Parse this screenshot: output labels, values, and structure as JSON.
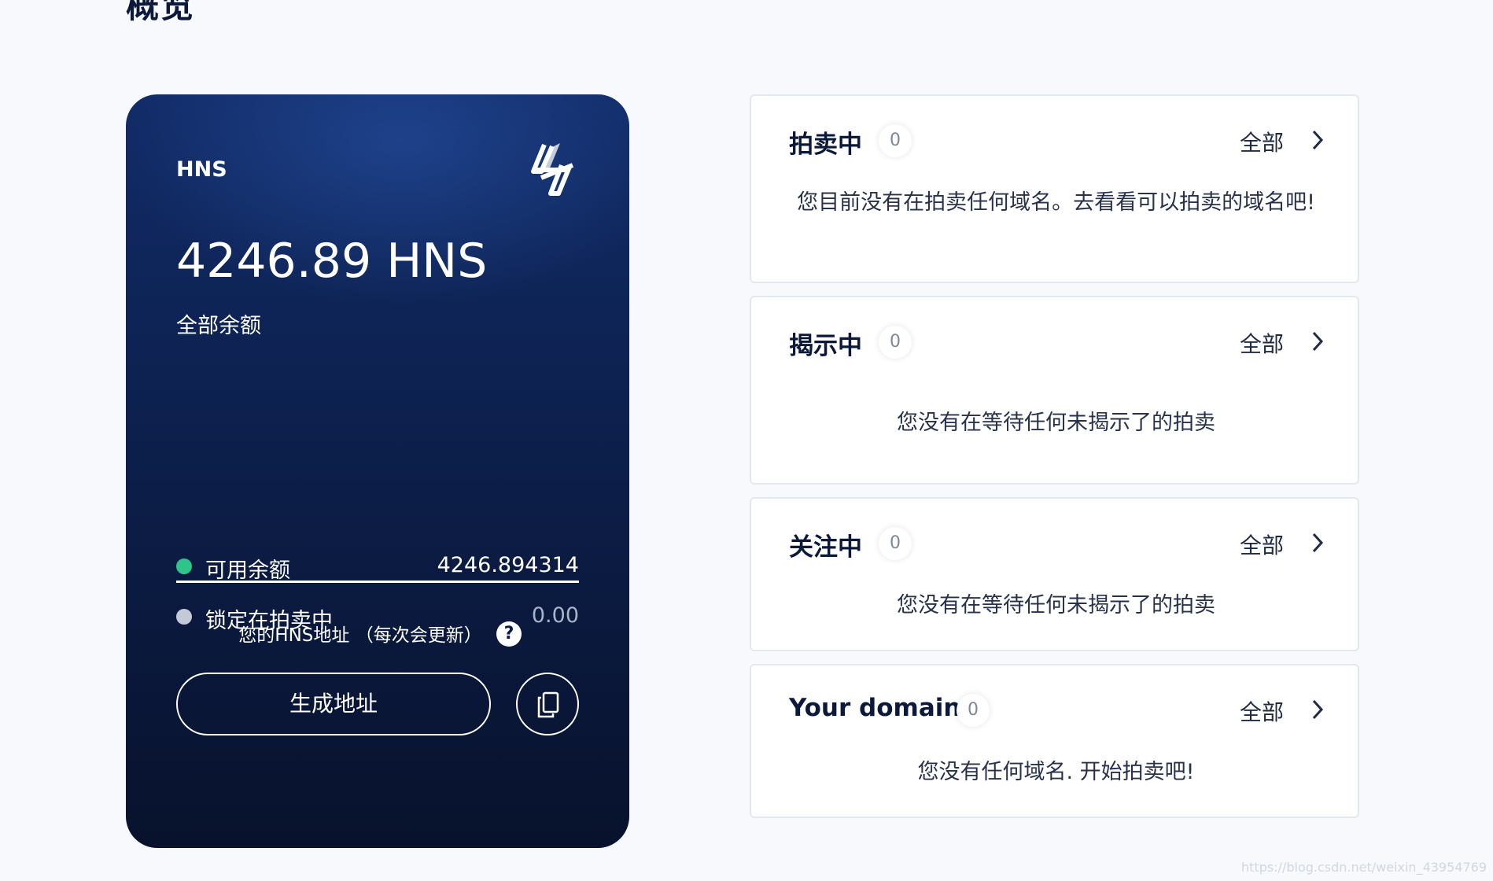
{
  "page": {
    "title": "概览"
  },
  "wallet": {
    "label": "HNS",
    "balance": "4246.89 HNS",
    "balance_label": "全部余额",
    "available": {
      "label": "可用余额",
      "value": "4246.894314",
      "color": "#2ec58a"
    },
    "locked": {
      "label": "锁定在拍卖中",
      "value": "0.00",
      "color": "#c3c9d6"
    },
    "address_label": "您的HNS地址 （每次会更新）",
    "help_icon_text": "?",
    "generate_button": "生成地址",
    "copy_icon": "copy-icon",
    "logo_icon": "handshake-logo-icon"
  },
  "panels": [
    {
      "title": "拍卖中",
      "count": "0",
      "link": "全部",
      "message": "您目前没有在拍卖任何域名。去看看可以拍卖的域名吧!"
    },
    {
      "title": "揭示中",
      "count": "0",
      "link": "全部",
      "message": "您没有在等待任何未揭示了的拍卖"
    },
    {
      "title": "关注中",
      "count": "0",
      "link": "全部",
      "message": "您没有在等待任何未揭示了的拍卖"
    },
    {
      "title": "Your domains",
      "count": "0",
      "link": "全部",
      "message": "您没有任何域名. 开始拍卖吧!"
    }
  ],
  "watermark": "https://blog.csdn.net/weixin_43954769"
}
